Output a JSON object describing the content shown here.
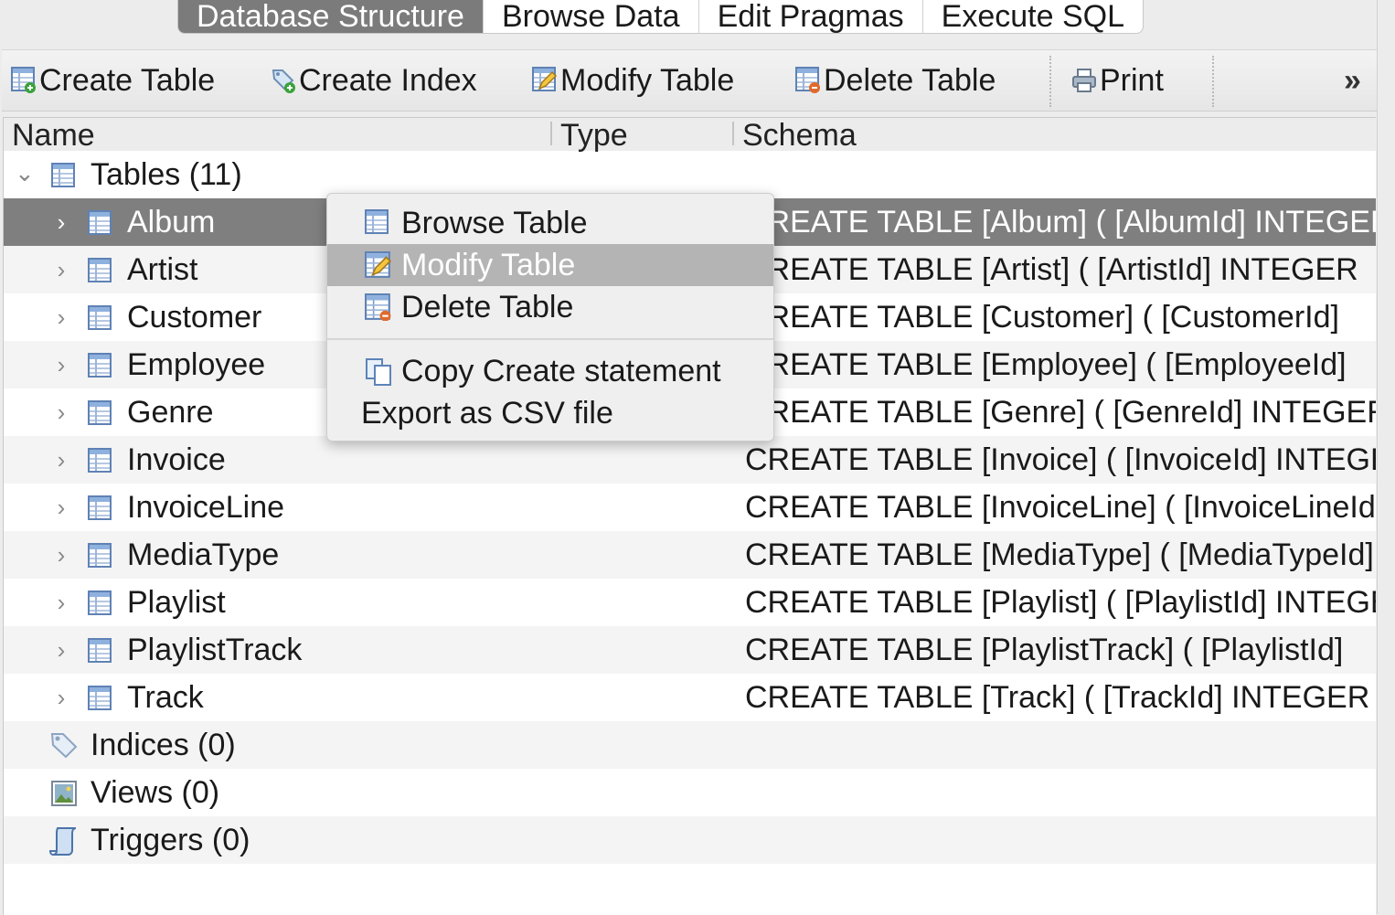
{
  "tabs": [
    "Database Structure",
    "Browse Data",
    "Edit Pragmas",
    "Execute SQL"
  ],
  "toolbar": {
    "create_table": "Create Table",
    "create_index": "Create Index",
    "modify_table": "Modify Table",
    "delete_table": "Delete Table",
    "print": "Print",
    "overflow": "»"
  },
  "columns": {
    "name": "Name",
    "type": "Type",
    "schema": "Schema"
  },
  "tree": {
    "tables_label": "Tables (11)",
    "tables": [
      {
        "name": "Album",
        "schema": "CREATE TABLE [Album] ( [AlbumId] INTEGER"
      },
      {
        "name": "Artist",
        "schema": "CREATE TABLE [Artist] ( [ArtistId] INTEGER"
      },
      {
        "name": "Customer",
        "schema": "CREATE TABLE [Customer] ( [CustomerId]"
      },
      {
        "name": "Employee",
        "schema": "CREATE TABLE [Employee] ( [EmployeeId]"
      },
      {
        "name": "Genre",
        "schema": "CREATE TABLE [Genre] ( [GenreId] INTEGER"
      },
      {
        "name": "Invoice",
        "schema": "CREATE TABLE [Invoice] ( [InvoiceId] INTEGER"
      },
      {
        "name": "InvoiceLine",
        "schema": "CREATE TABLE [InvoiceLine] ( [InvoiceLineId]"
      },
      {
        "name": "MediaType",
        "schema": "CREATE TABLE [MediaType] ( [MediaTypeId]"
      },
      {
        "name": "Playlist",
        "schema": "CREATE TABLE [Playlist] ( [PlaylistId] INTEGER"
      },
      {
        "name": "PlaylistTrack",
        "schema": "CREATE TABLE [PlaylistTrack] ( [PlaylistId]"
      },
      {
        "name": "Track",
        "schema": "CREATE TABLE [Track] ( [TrackId] INTEGER"
      }
    ],
    "indices_label": "Indices (0)",
    "views_label": "Views (0)",
    "triggers_label": "Triggers (0)"
  },
  "context_menu": {
    "browse_table": "Browse Table",
    "modify_table": "Modify Table",
    "delete_table": "Delete Table",
    "copy_create": "Copy Create statement",
    "export_csv": "Export as CSV file"
  }
}
